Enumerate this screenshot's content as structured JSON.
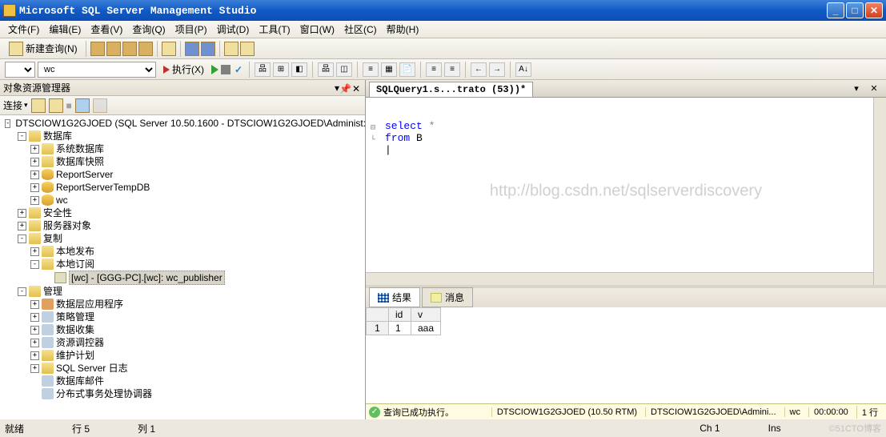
{
  "titlebar": {
    "title": "Microsoft SQL Server Management Studio"
  },
  "menu": {
    "file": "文件(F)",
    "edit": "编辑(E)",
    "view": "查看(V)",
    "query": "查询(Q)",
    "project": "项目(P)",
    "debug": "调试(D)",
    "tools": "工具(T)",
    "window": "窗口(W)",
    "community": "社区(C)",
    "help": "帮助(H)"
  },
  "toolbar": {
    "new_query": "新建查询(N)",
    "db_combo": "wc",
    "execute": "执行(X)"
  },
  "objexplorer": {
    "title": "对象资源管理器",
    "connect": "连接",
    "server": "DTSCIOW1G2GJOED (SQL Server 10.50.1600 - DTSCIOW1G2GJOED\\Administ:",
    "databases": "数据库",
    "sys_db": "系统数据库",
    "db_snapshots": "数据库快照",
    "db_report": "ReportServer",
    "db_report_temp": "ReportServerTempDB",
    "db_wc": "wc",
    "security": "安全性",
    "server_objs": "服务器对象",
    "replication": "复制",
    "local_pub": "本地发布",
    "local_sub": "本地订阅",
    "sub_item": "[wc] - [GGG-PC].[wc]: wc_publisher",
    "management": "管理",
    "data_tier": "数据层应用程序",
    "policy": "策略管理",
    "data_collect": "数据收集",
    "resource_gov": "资源调控器",
    "maint_plan": "维护计划",
    "sql_logs": "SQL Server 日志",
    "db_mail": "数据库邮件",
    "dtc": "分布式事务处理协调器"
  },
  "editor": {
    "tab_title": "SQLQuery1.s...trato (53))*",
    "sql_line1_kw": "select",
    "sql_line1_rest": " *",
    "sql_line2_kw": "from",
    "sql_line2_rest": " B",
    "watermark": "http://blog.csdn.net/sqlserverdiscovery"
  },
  "results": {
    "tab_results": "结果",
    "tab_messages": "消息",
    "col1": "id",
    "col2": "v",
    "row1_num": "1",
    "row1_id": "1",
    "row1_v": "aaa",
    "status_msg": "查询已成功执行。",
    "status_server": "DTSCIOW1G2GJOED (10.50 RTM)",
    "status_user": "DTSCIOW1G2GJOED\\Admini...",
    "status_db": "wc",
    "status_time": "00:00:00",
    "status_rows": "1 行"
  },
  "bottom": {
    "state": "就绪",
    "line": "行 5",
    "col": "列 1",
    "ch": "Ch 1",
    "ins": "Ins",
    "watermark": "©51CTO博客"
  }
}
